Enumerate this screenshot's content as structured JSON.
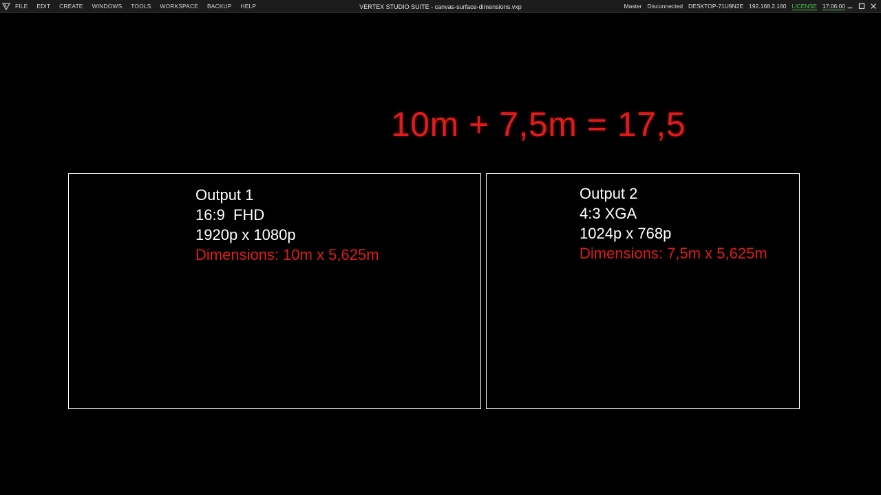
{
  "app": {
    "window_title": "VERTEX STUDIO SUITE - canvas-surface-dimensions.vxp"
  },
  "menu": {
    "items": [
      "FILE",
      "EDIT",
      "CREATE",
      "WINDOWS",
      "TOOLS",
      "WORKSPACE",
      "BACKUP",
      "HELP"
    ]
  },
  "status": {
    "role": "Master",
    "connection": "Disconnected",
    "host": "DESKTOP-71U9N2E",
    "ip": "192.168.2.160",
    "license": "LICENSE",
    "time": "17:06:00"
  },
  "canvas": {
    "formula": "10m + 7,5m = 17,5",
    "outputs": [
      {
        "name": "Output 1",
        "ratio": "16:9  FHD",
        "resolution": "1920p x 1080p",
        "dimensions": "Dimensions: 10m x 5,625m"
      },
      {
        "name": "Output 2",
        "ratio": "4:3 XGA",
        "resolution": "1024p x 768p",
        "dimensions": "Dimensions: 7,5m x 5,625m"
      }
    ]
  },
  "colors": {
    "background": "#000000",
    "accent_red": "#e11b1b",
    "license_green": "#4ec24e",
    "outline": "#ffffff"
  },
  "icons": {
    "logo": "app-logo-icon",
    "minimize": "minimize-icon",
    "maximize": "maximize-icon",
    "close": "close-icon"
  }
}
